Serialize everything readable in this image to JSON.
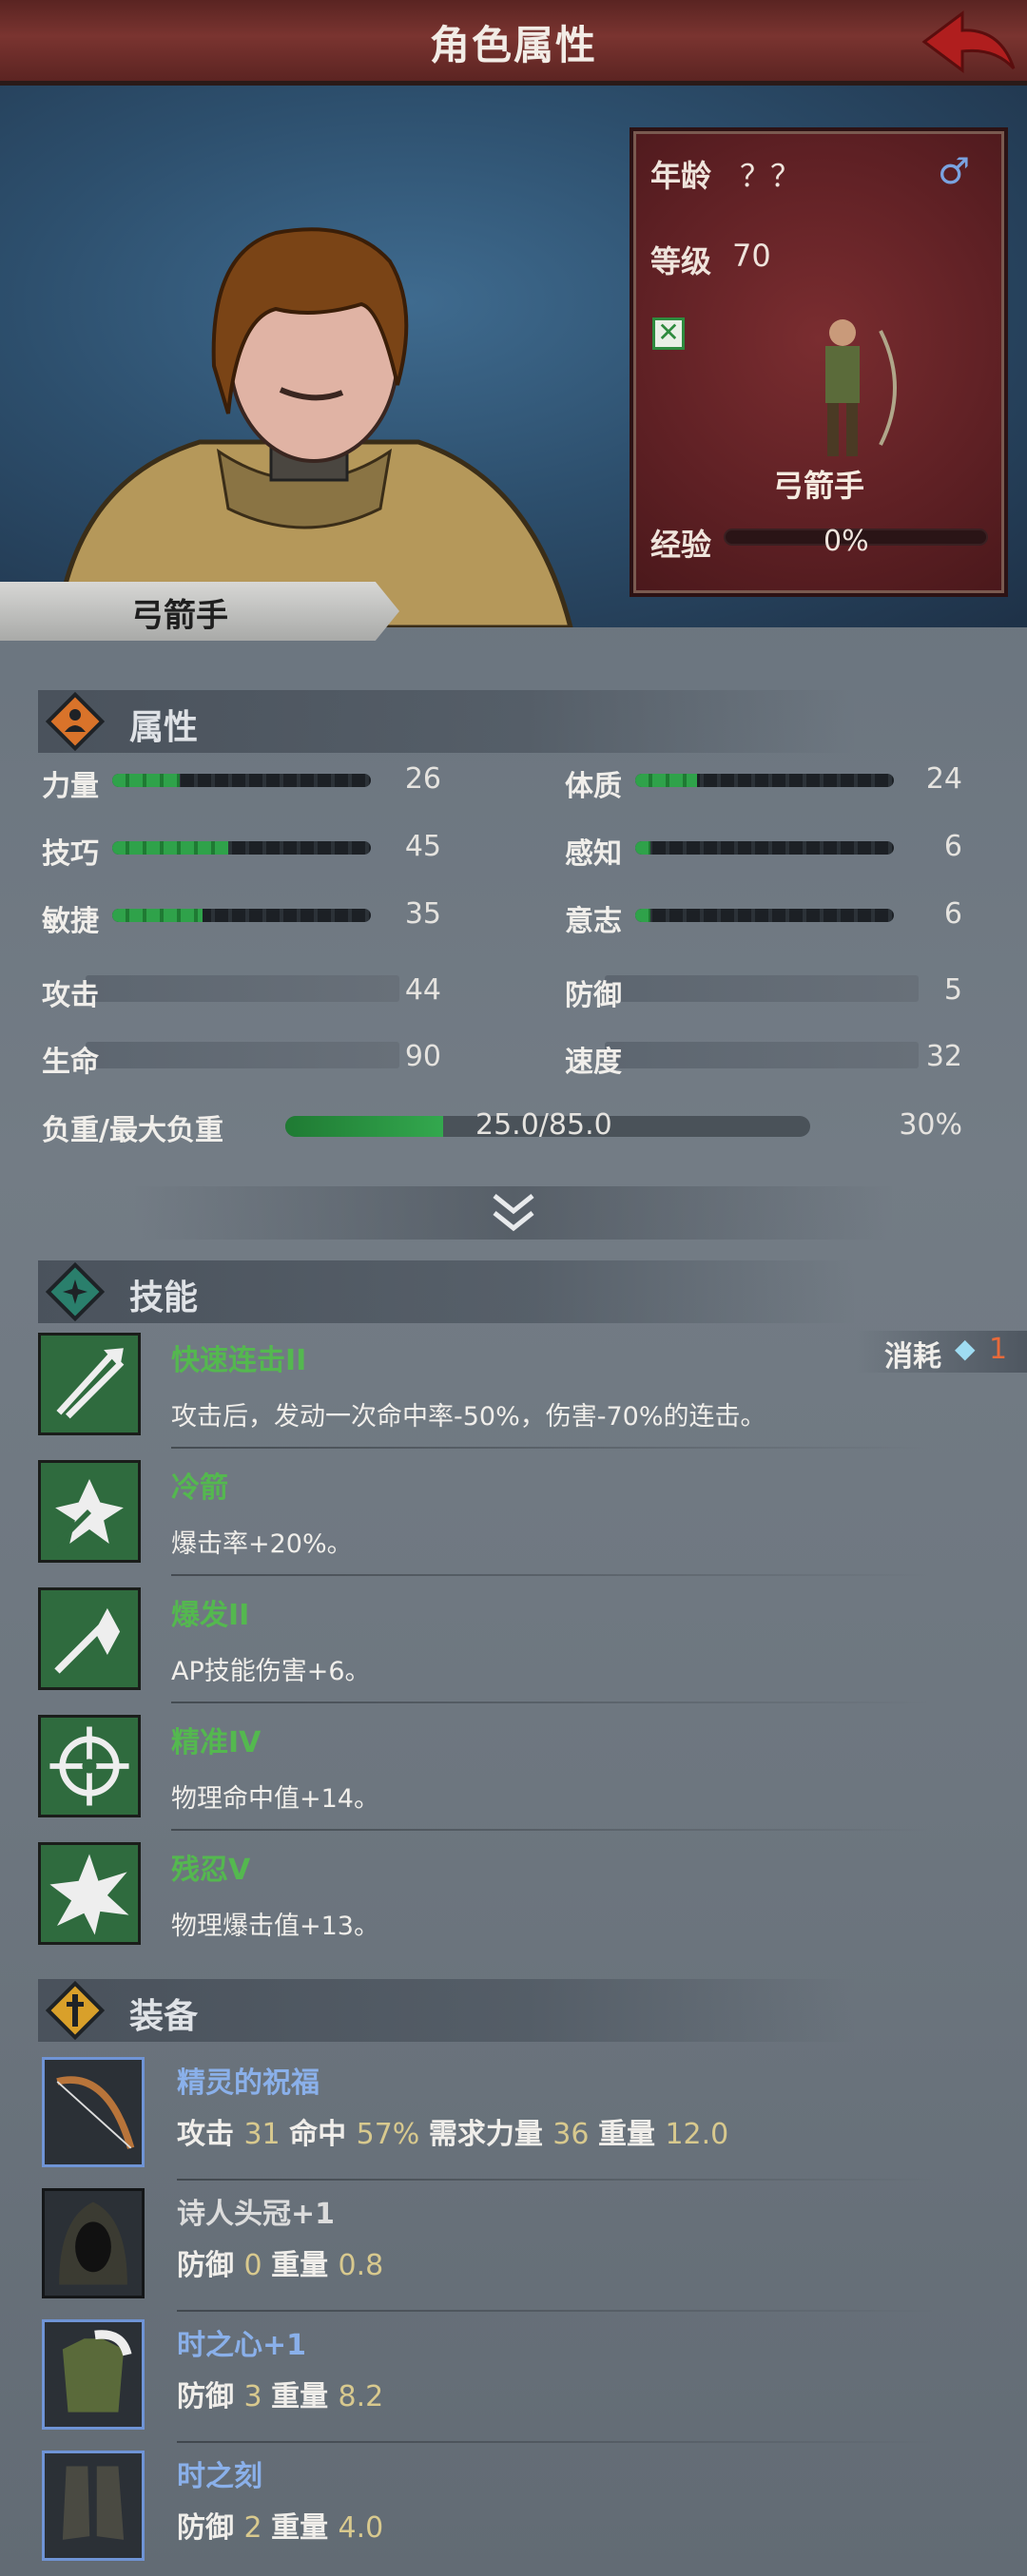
{
  "header": {
    "title": "角色属性"
  },
  "hero": {
    "name_tag": "弓箭手"
  },
  "info_card": {
    "age_label": "年龄",
    "age_value": "？？",
    "gender_icon": "male-icon",
    "level_label": "等级",
    "level_value": "70",
    "class_name": "弓箭手",
    "exp_label": "经验",
    "exp_value": "0%",
    "exp_progress": 0
  },
  "attributes": {
    "title": "属性",
    "segmented": [
      {
        "label": "力量",
        "value": "26",
        "fill": 0.26
      },
      {
        "label": "体质",
        "value": "24",
        "fill": 0.24
      },
      {
        "label": "技巧",
        "value": "45",
        "fill": 0.45
      },
      {
        "label": "感知",
        "value": "6",
        "fill": 0.06
      },
      {
        "label": "敏捷",
        "value": "35",
        "fill": 0.35
      },
      {
        "label": "意志",
        "value": "6",
        "fill": 0.06
      }
    ],
    "plain": [
      {
        "label": "攻击",
        "value": "44"
      },
      {
        "label": "防御",
        "value": "5"
      },
      {
        "label": "生命",
        "value": "90"
      },
      {
        "label": "速度",
        "value": "32"
      }
    ],
    "load_label": "负重/最大负重",
    "load_value": "25.0/85.0",
    "load_percent": "30%",
    "load_fraction": 0.3
  },
  "skills": {
    "title": "技能",
    "cost_label": "消耗",
    "cost_value": "1",
    "items": [
      {
        "name": "快速连击II",
        "desc": "攻击后，发动一次命中率-50%，伤害-70%的连击。",
        "icon": "double-arrow-icon"
      },
      {
        "name": "冷箭",
        "desc": "爆击率+20%。",
        "icon": "cold-arrow-icon"
      },
      {
        "name": "爆发II",
        "desc": "AP技能伤害+6。",
        "icon": "burst-sword-icon"
      },
      {
        "name": "精准IV",
        "desc": "物理命中值+14。",
        "icon": "crosshair-icon"
      },
      {
        "name": "残忍V",
        "desc": "物理爆击值+13。",
        "icon": "spike-burst-icon"
      }
    ]
  },
  "equipment": {
    "title": "装备",
    "items": [
      {
        "name": "精灵的祝福",
        "name_color": "#8ab0ea",
        "stats": [
          [
            "攻击",
            "31"
          ],
          [
            "命中",
            "57%"
          ],
          [
            "需求力量",
            "36"
          ],
          [
            "重量",
            "12.0"
          ]
        ],
        "icon": "bow-icon"
      },
      {
        "name": "诗人头冠+1",
        "name_color": "#dcdcdc",
        "stats": [
          [
            "防御",
            "0"
          ],
          [
            "重量",
            "0.8"
          ]
        ],
        "icon": "hood-icon"
      },
      {
        "name": "时之心+1",
        "name_color": "#8ab0ea",
        "stats": [
          [
            "防御",
            "3"
          ],
          [
            "重量",
            "8.2"
          ]
        ],
        "icon": "armor-icon"
      },
      {
        "name": "时之刻",
        "name_color": "#8ab0ea",
        "stats": [
          [
            "防御",
            "2"
          ],
          [
            "重量",
            "4.0"
          ]
        ],
        "icon": "boots-icon"
      }
    ]
  }
}
